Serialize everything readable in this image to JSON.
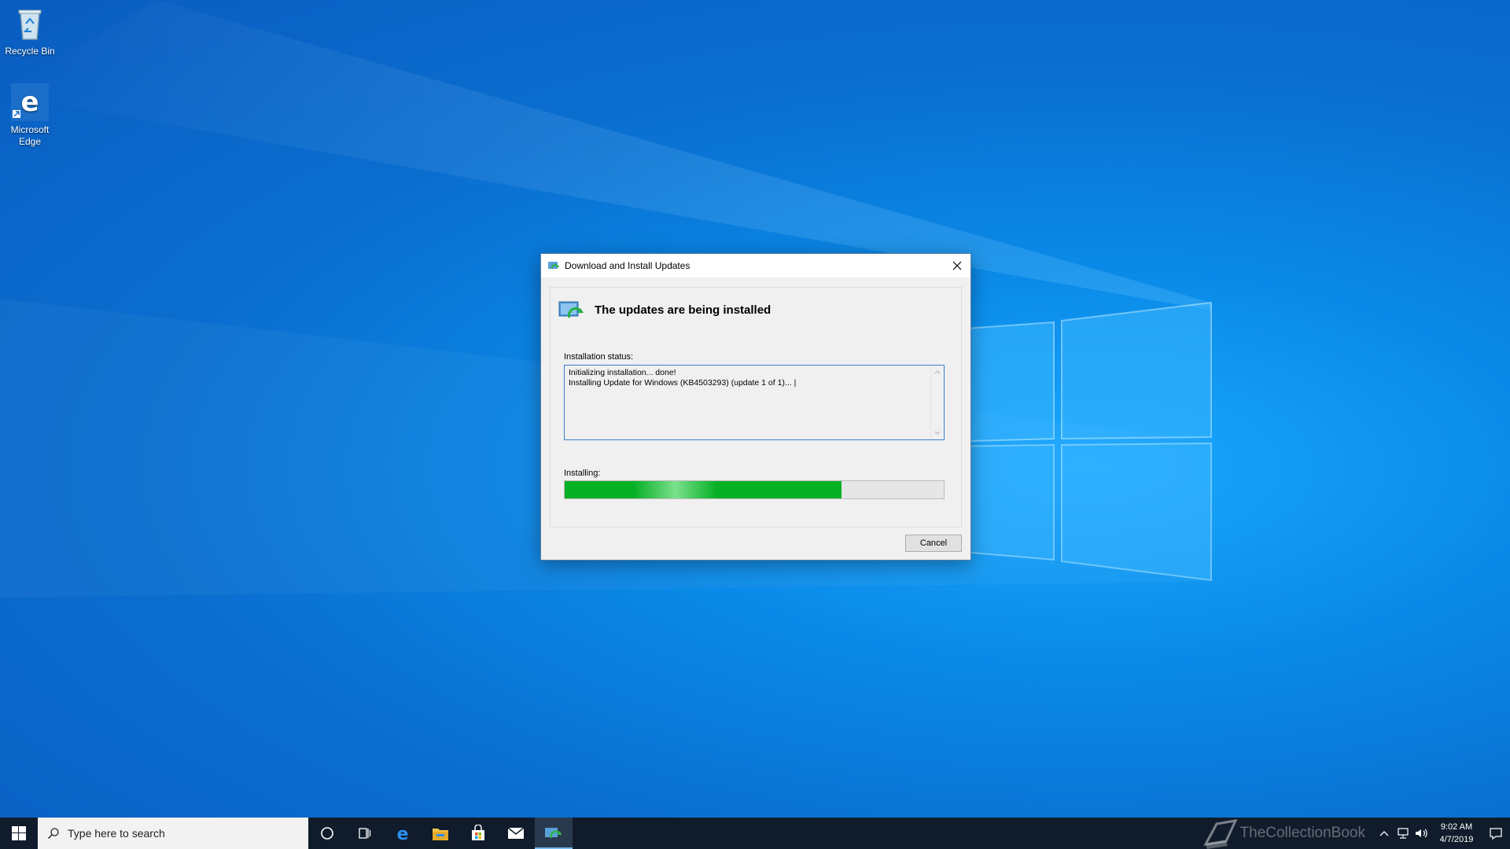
{
  "desktop": {
    "icons": [
      {
        "label": "Recycle Bin"
      },
      {
        "label": "Microsoft Edge"
      }
    ]
  },
  "dialog": {
    "title": "Download and Install Updates",
    "heading": "The updates are being installed",
    "status_label": "Installation status:",
    "status_lines": [
      "Initializing installation... done!",
      "Installing Update for Windows (KB4503293) (update 1 of 1)..."
    ],
    "progress_label": "Installing:",
    "progress_fraction": 0.73,
    "cancel_label": "Cancel",
    "colors": {
      "progress": "#06b025",
      "border": "#3c7fd0"
    }
  },
  "taskbar": {
    "search_placeholder": "Type here to search",
    "pinned": [
      "cortana-icon",
      "task-view-icon",
      "edge-icon",
      "file-explorer-icon",
      "store-icon",
      "mail-icon",
      "windows-update-icon"
    ],
    "watermark": "TheCollectionBook",
    "time": "9:02 AM",
    "date": "4/7/2019"
  }
}
